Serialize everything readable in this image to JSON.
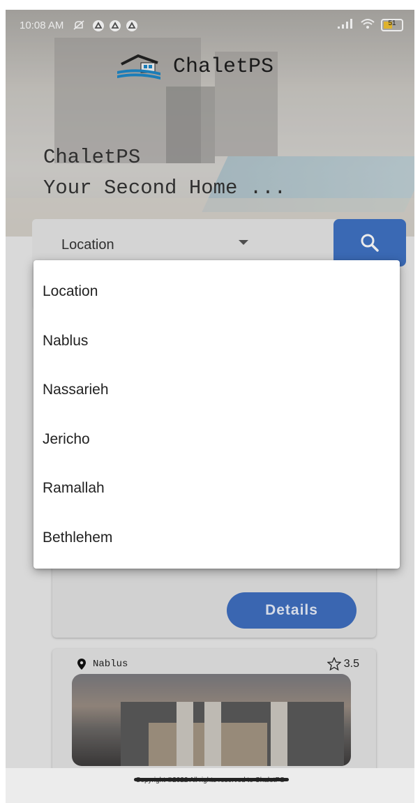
{
  "status_bar": {
    "time": "10:08 AM",
    "battery": "51",
    "icons": [
      "mute-icon",
      "app-notification-icon",
      "app-notification-icon",
      "app-notification-icon",
      "signal-icon",
      "wifi-icon",
      "battery-icon"
    ]
  },
  "brand": {
    "name": "ChaletPS"
  },
  "hero": {
    "line1": "ChaletPS",
    "line2": "Your Second Home ..."
  },
  "search": {
    "selected": "Location",
    "button_icon": "search-icon"
  },
  "dropdown": {
    "options": [
      "Location",
      "Nablus",
      "Nassarieh",
      "Jericho",
      "Ramallah",
      "Bethlehem"
    ]
  },
  "card_partial": {
    "details_label": "Details"
  },
  "listing": {
    "location": "Nablus",
    "rating": "3.5"
  },
  "footer": {
    "copyright": "Copyright ©2022 All rights reserved to ChaletPS"
  },
  "colors": {
    "accent": "#3f72c4",
    "battery": "#f1c232"
  }
}
